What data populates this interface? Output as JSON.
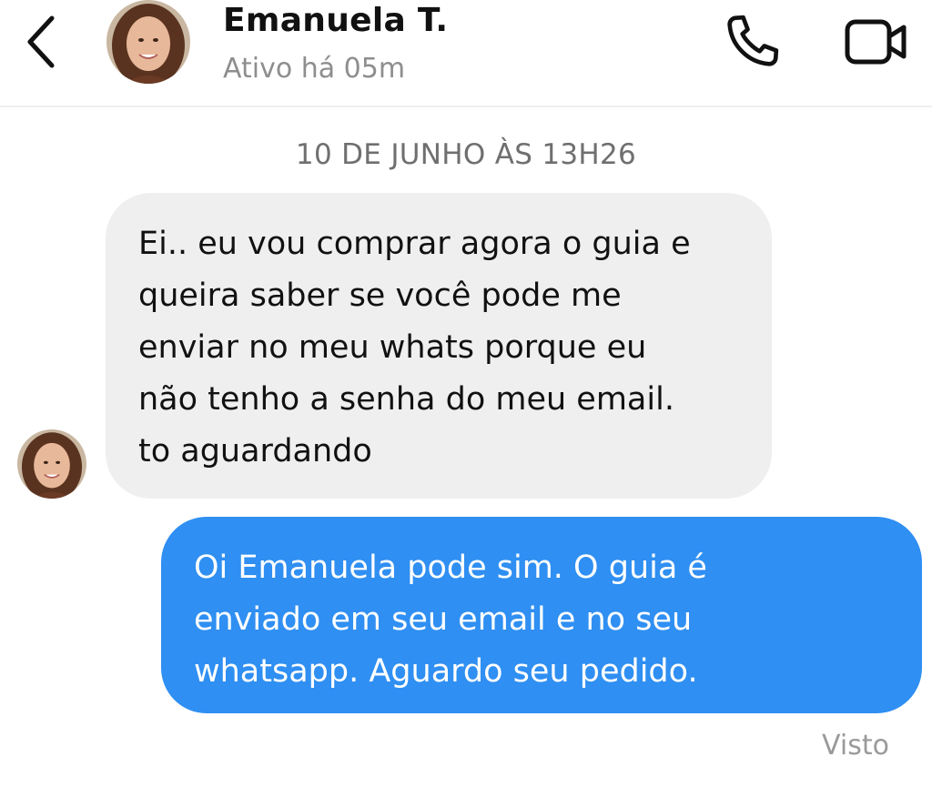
{
  "header": {
    "contact_name": "Emanuela T.",
    "status": "Ativo há 05m",
    "back_icon": "chevron-left-icon",
    "call_icon": "phone-icon",
    "video_icon": "video-camera-icon"
  },
  "conversation": {
    "timestamp": "10 DE JUNHO ÀS 13H26",
    "incoming": {
      "lines": [
        "Ei.. eu vou comprar agora o guia e",
        "queira saber se você pode me",
        "enviar no meu whats porque eu",
        "não tenho a senha do meu email.",
        "to aguardando"
      ]
    },
    "outgoing": {
      "lines": [
        "Oi Emanuela pode sim. O guia é",
        "enviado em seu email e no seu",
        "whatsapp. Aguardo seu pedido."
      ]
    },
    "seen_label": "Visto"
  },
  "colors": {
    "outgoing_bubble": "#2f8ff2",
    "incoming_bubble": "#efefef",
    "muted_text": "#8e8e8e"
  }
}
